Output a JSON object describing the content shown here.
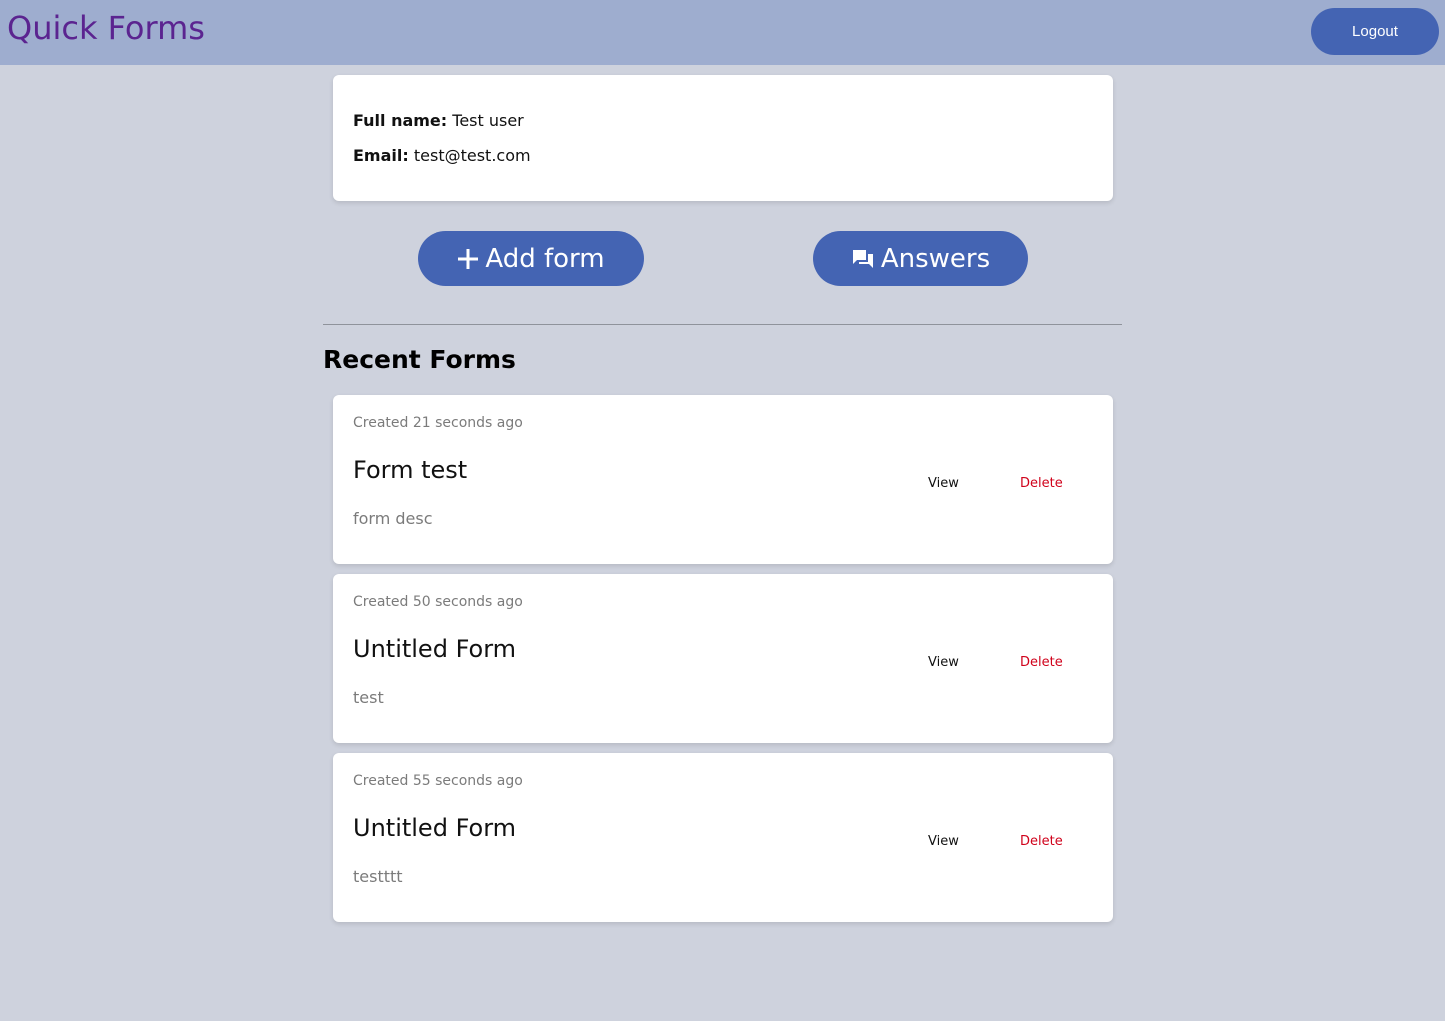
{
  "header": {
    "title": "Quick Forms",
    "logout_label": "Logout"
  },
  "profile": {
    "name_label": "Full name:",
    "name_value": "Test user",
    "email_label": "Email:",
    "email_value": "test@test.com"
  },
  "actions": {
    "add_form_label": "Add form",
    "add_form_icon": "plus-icon",
    "answers_label": "Answers",
    "answers_icon": "chat-icon"
  },
  "recent": {
    "title": "Recent Forms",
    "forms": [
      {
        "created": "Created 21 seconds ago",
        "title": "Form test",
        "description": "form desc",
        "view_label": "View",
        "delete_label": "Delete"
      },
      {
        "created": "Created 50 seconds ago",
        "title": "Untitled Form",
        "description": "test",
        "view_label": "View",
        "delete_label": "Delete"
      },
      {
        "created": "Created 55 seconds ago",
        "title": "Untitled Form",
        "description": "testttt",
        "view_label": "View",
        "delete_label": "Delete"
      }
    ]
  },
  "colors": {
    "header_bg": "#9eadcf",
    "title_color": "#5b2490",
    "accent": "#4464b3",
    "page_bg": "#ced2dd",
    "delete_color": "#d0021b"
  }
}
